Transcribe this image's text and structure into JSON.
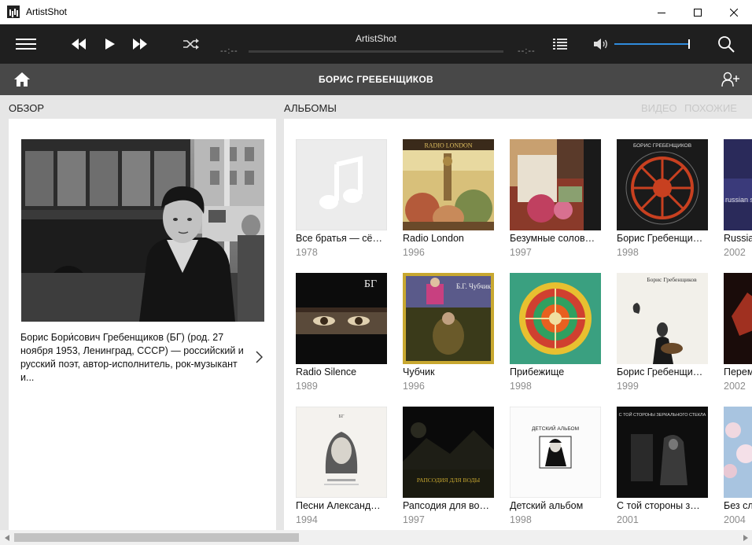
{
  "window": {
    "title": "ArtistShot"
  },
  "player": {
    "track_title": "ArtistShot",
    "time_elapsed": "--:--",
    "time_total": "--:--",
    "progress": 0,
    "volume": 1.0,
    "accent": "#2f8bdc"
  },
  "header": {
    "artist_name": "БОРИС ГРЕБЕНЩИКОВ"
  },
  "overview": {
    "label": "ОБЗОР",
    "bio": "Борис Бори́сович Гребенщиков (БГ) (род. 27 ноября 1953, Ленинград, СССР) — российский и русский поэт, автор-исполнитель, рок-музыкант и..."
  },
  "albums_section": {
    "label": "АЛЬБОМЫ",
    "tabs": [
      "ВИДЕО",
      "ПОХОЖИЕ"
    ]
  },
  "albums": [
    {
      "title": "Все братья — сё…",
      "year": "1978",
      "cover": "placeholder"
    },
    {
      "title": "Radio London",
      "year": "1996",
      "cover": "radio-london",
      "cover_text": "RADIO LONDON"
    },
    {
      "title": "Безумные солов…",
      "year": "1997",
      "cover": "collage"
    },
    {
      "title": "Борис Гребенщи…",
      "year": "1998",
      "cover": "wheel-dark",
      "cover_text": "БОРИС ГРЕБЕНЩИКОВ"
    },
    {
      "title": "Russia",
      "year": "2002",
      "cover": "russia",
      "cover_text": "russian s"
    },
    {
      "title": "Radio Silence",
      "year": "1989",
      "cover": "eyes",
      "cover_text": "БГ"
    },
    {
      "title": "Чубчик",
      "year": "1996",
      "cover": "chubchik",
      "cover_text": "Б.Г. Чубчик"
    },
    {
      "title": "Прибежище",
      "year": "1998",
      "cover": "mandala"
    },
    {
      "title": "Борис Гребенщи…",
      "year": "1999",
      "cover": "guitar",
      "cover_text": "Борис Гребенщиков"
    },
    {
      "title": "Перем",
      "year": "2002",
      "cover": "dark-red"
    },
    {
      "title": "Песни Александ…",
      "year": "1994",
      "cover": "portrait",
      "cover_text": "БГ"
    },
    {
      "title": "Рапсодия для во…",
      "year": "1997",
      "cover": "night",
      "cover_text": "РАПСОДИЯ ДЛЯ ВОДЫ"
    },
    {
      "title": "Детский альбом",
      "year": "1998",
      "cover": "kids",
      "cover_text": "ДЕТСКИЙ АЛЬБОМ"
    },
    {
      "title": "С той стороны з…",
      "year": "2001",
      "cover": "mirror",
      "cover_text": "С ТОЙ СТОРОНЫ ЗЕРКАЛЬНОГО СТЕКЛА"
    },
    {
      "title": "Без сл",
      "year": "2004",
      "cover": "blossom"
    }
  ]
}
